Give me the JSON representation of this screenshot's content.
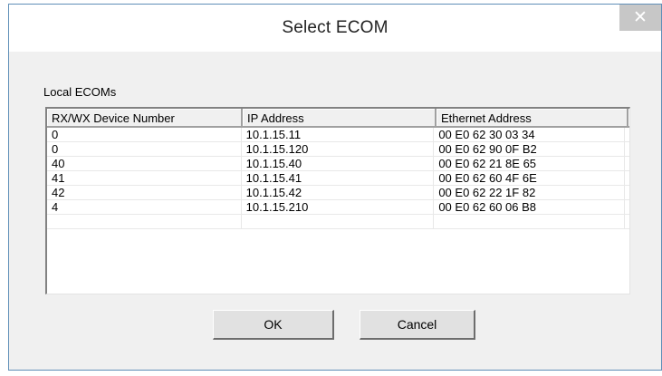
{
  "dialog": {
    "title": "Select ECOM",
    "close_symbol": "✕"
  },
  "group_label": "Local ECOMs",
  "table": {
    "columns": [
      "RX/WX Device Number",
      "IP Address",
      "Ethernet Address"
    ],
    "rows": [
      [
        "0",
        "10.1.15.11",
        "00 E0 62 30 03 34"
      ],
      [
        "0",
        "10.1.15.120",
        "00 E0 62 90 0F B2"
      ],
      [
        "40",
        "10.1.15.40",
        "00 E0 62 21 8E 65"
      ],
      [
        "41",
        "10.1.15.41",
        "00 E0 62 60 4F 6E"
      ],
      [
        "42",
        "10.1.15.42",
        "00 E0 62 22 1F 82"
      ],
      [
        "4",
        "10.1.15.210",
        "00 E0 62 60 06 B8"
      ],
      [
        "",
        "",
        ""
      ]
    ]
  },
  "buttons": {
    "ok_label": "OK",
    "cancel_label": "Cancel"
  }
}
